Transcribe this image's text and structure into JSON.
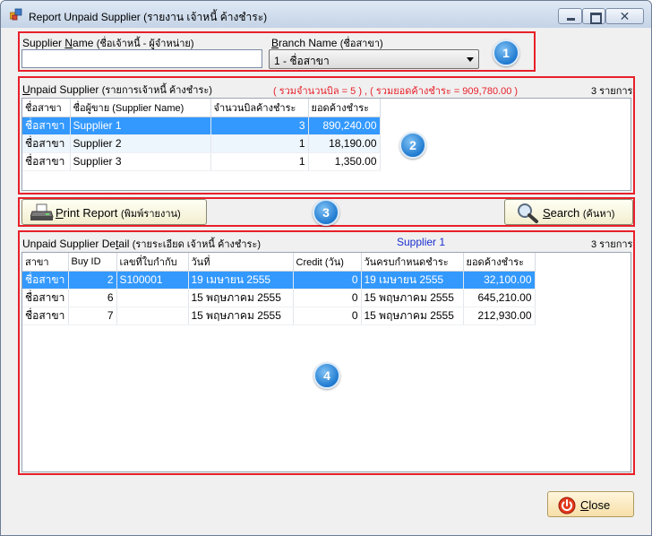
{
  "window": {
    "title": "Report Unpaid Supplier (รายงาน เจ้าหนี้ ค้างชำระ)",
    "minimize_glyph": "",
    "close_glyph": "✕"
  },
  "badges": [
    "1",
    "2",
    "3",
    "4"
  ],
  "filters": {
    "supplier_label_ul": "N",
    "supplier_label_pre": "Supplier ",
    "supplier_label_post": "ame",
    "supplier_label_thai": "(ชื่อเจ้าหนี้ - ผู้จำหน่าย)",
    "supplier_value": "",
    "branch_label_ul": "B",
    "branch_label_post": "ranch Name",
    "branch_label_thai": "(ชื่อสาขา)",
    "branch_selected": "1 - ชื่อสาขา"
  },
  "unpaid": {
    "heading_ul": "U",
    "heading_post": "npaid Supplier",
    "heading_thai": "(รายการเจ้าหนี้ ค้างชำระ)",
    "summary": "( รวมจำนวนบิล = 5 ) , ( รวมยอดค้างชำระ = 909,780.00 )",
    "count": "3 รายการ",
    "columns": [
      "ชื่อสาขา",
      "ชื่อผู้ขาย  (Supplier Name)",
      "จำนวนบิลค้างชำระ",
      "ยอดค้างชำระ"
    ],
    "rows": [
      [
        "ชื่อสาขา",
        "Supplier 1",
        "3",
        "890,240.00"
      ],
      [
        "ชื่อสาขา",
        "Supplier 2",
        "1",
        "18,190.00"
      ],
      [
        "ชื่อสาขา",
        "Supplier 3",
        "1",
        "1,350.00"
      ]
    ]
  },
  "actions": {
    "print_ul": "P",
    "print_post": "rint Report",
    "print_thai": "(พิมพ์รายงาน)",
    "search_ul": "S",
    "search_post": "earch",
    "search_thai": "(ค้นหา)"
  },
  "detail": {
    "heading_pre": "Unpaid Supplier De",
    "heading_ul": "t",
    "heading_post": "ail",
    "heading_thai": "(รายระเอียด เจ้าหนี้ ค้างชำระ)",
    "selected_supplier": "Supplier 1",
    "count": "3 รายการ",
    "columns": [
      "สาขา",
      "Buy ID",
      "เลขที่ใบกำกับ",
      "วันที่",
      "Credit  (วัน)",
      "วันครบกำหนดชำระ",
      "ยอดค้างชำระ"
    ],
    "rows": [
      [
        "ชื่อสาขา",
        "2",
        "S100001",
        "  19 เมษายน  2555",
        "0",
        "  19 เมษายน  2555",
        "32,100.00"
      ],
      [
        "ชื่อสาขา",
        "6",
        "",
        "15 พฤษภาคม  2555",
        "0",
        "15 พฤษภาคม  2555",
        "645,210.00"
      ],
      [
        "ชื่อสาขา",
        "7",
        "",
        "15 พฤษภาคม  2555",
        "0",
        "15 พฤษภาคม  2555",
        "212,930.00"
      ]
    ]
  },
  "footer": {
    "close_ul": "C",
    "close_post": "lose"
  },
  "colors": {
    "annotation_red": "#e8202a",
    "summary_red": "#e8202a",
    "supplier_blue": "#1a2fd0",
    "selection": "#3399ff",
    "badge_blue": "#1f7ad0"
  },
  "icons": [
    "app-icon",
    "minimize-icon",
    "maximize-icon",
    "close-icon",
    "printer-icon",
    "magnifier-icon",
    "power-icon"
  ]
}
